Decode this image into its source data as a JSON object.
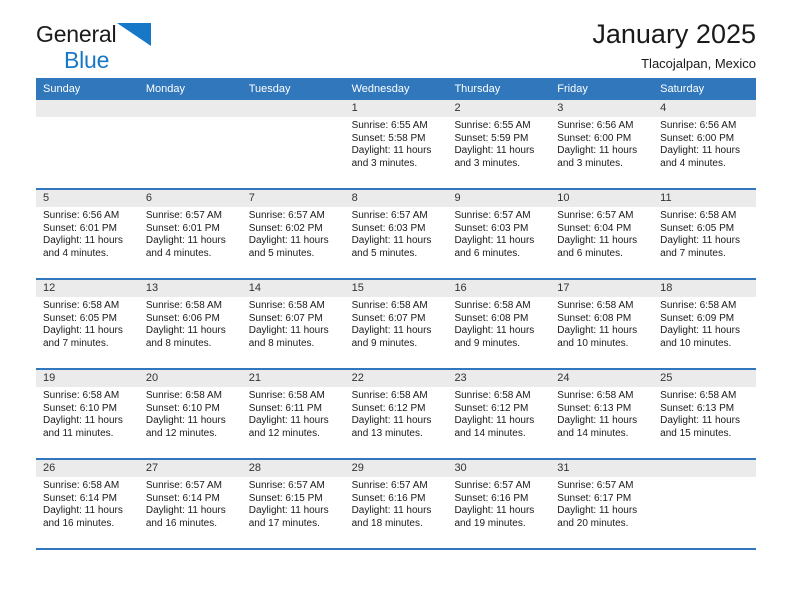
{
  "brand": {
    "word1": "General",
    "word2": "Blue",
    "triangle_color": "#1878c8",
    "text_color": "#1a1a1a"
  },
  "header": {
    "title": "January 2025",
    "subtitle": "Tlacojalpan, Mexico"
  },
  "theme": {
    "header_band": "#3077bc",
    "daynum_band": "#ebebeb",
    "separator": "#3077bc"
  },
  "weekday_headers": [
    "Sunday",
    "Monday",
    "Tuesday",
    "Wednesday",
    "Thursday",
    "Friday",
    "Saturday"
  ],
  "weeks": [
    [
      {
        "day": "",
        "empty": true,
        "sunrise": "",
        "sunset": "",
        "daylight1": "",
        "daylight2": ""
      },
      {
        "day": "",
        "empty": true,
        "sunrise": "",
        "sunset": "",
        "daylight1": "",
        "daylight2": ""
      },
      {
        "day": "",
        "empty": true,
        "sunrise": "",
        "sunset": "",
        "daylight1": "",
        "daylight2": ""
      },
      {
        "day": "1",
        "empty": false,
        "sunrise": "Sunrise: 6:55 AM",
        "sunset": "Sunset: 5:58 PM",
        "daylight1": "Daylight: 11 hours",
        "daylight2": "and 3 minutes."
      },
      {
        "day": "2",
        "empty": false,
        "sunrise": "Sunrise: 6:55 AM",
        "sunset": "Sunset: 5:59 PM",
        "daylight1": "Daylight: 11 hours",
        "daylight2": "and 3 minutes."
      },
      {
        "day": "3",
        "empty": false,
        "sunrise": "Sunrise: 6:56 AM",
        "sunset": "Sunset: 6:00 PM",
        "daylight1": "Daylight: 11 hours",
        "daylight2": "and 3 minutes."
      },
      {
        "day": "4",
        "empty": false,
        "sunrise": "Sunrise: 6:56 AM",
        "sunset": "Sunset: 6:00 PM",
        "daylight1": "Daylight: 11 hours",
        "daylight2": "and 4 minutes."
      }
    ],
    [
      {
        "day": "5",
        "empty": false,
        "sunrise": "Sunrise: 6:56 AM",
        "sunset": "Sunset: 6:01 PM",
        "daylight1": "Daylight: 11 hours",
        "daylight2": "and 4 minutes."
      },
      {
        "day": "6",
        "empty": false,
        "sunrise": "Sunrise: 6:57 AM",
        "sunset": "Sunset: 6:01 PM",
        "daylight1": "Daylight: 11 hours",
        "daylight2": "and 4 minutes."
      },
      {
        "day": "7",
        "empty": false,
        "sunrise": "Sunrise: 6:57 AM",
        "sunset": "Sunset: 6:02 PM",
        "daylight1": "Daylight: 11 hours",
        "daylight2": "and 5 minutes."
      },
      {
        "day": "8",
        "empty": false,
        "sunrise": "Sunrise: 6:57 AM",
        "sunset": "Sunset: 6:03 PM",
        "daylight1": "Daylight: 11 hours",
        "daylight2": "and 5 minutes."
      },
      {
        "day": "9",
        "empty": false,
        "sunrise": "Sunrise: 6:57 AM",
        "sunset": "Sunset: 6:03 PM",
        "daylight1": "Daylight: 11 hours",
        "daylight2": "and 6 minutes."
      },
      {
        "day": "10",
        "empty": false,
        "sunrise": "Sunrise: 6:57 AM",
        "sunset": "Sunset: 6:04 PM",
        "daylight1": "Daylight: 11 hours",
        "daylight2": "and 6 minutes."
      },
      {
        "day": "11",
        "empty": false,
        "sunrise": "Sunrise: 6:58 AM",
        "sunset": "Sunset: 6:05 PM",
        "daylight1": "Daylight: 11 hours",
        "daylight2": "and 7 minutes."
      }
    ],
    [
      {
        "day": "12",
        "empty": false,
        "sunrise": "Sunrise: 6:58 AM",
        "sunset": "Sunset: 6:05 PM",
        "daylight1": "Daylight: 11 hours",
        "daylight2": "and 7 minutes."
      },
      {
        "day": "13",
        "empty": false,
        "sunrise": "Sunrise: 6:58 AM",
        "sunset": "Sunset: 6:06 PM",
        "daylight1": "Daylight: 11 hours",
        "daylight2": "and 8 minutes."
      },
      {
        "day": "14",
        "empty": false,
        "sunrise": "Sunrise: 6:58 AM",
        "sunset": "Sunset: 6:07 PM",
        "daylight1": "Daylight: 11 hours",
        "daylight2": "and 8 minutes."
      },
      {
        "day": "15",
        "empty": false,
        "sunrise": "Sunrise: 6:58 AM",
        "sunset": "Sunset: 6:07 PM",
        "daylight1": "Daylight: 11 hours",
        "daylight2": "and 9 minutes."
      },
      {
        "day": "16",
        "empty": false,
        "sunrise": "Sunrise: 6:58 AM",
        "sunset": "Sunset: 6:08 PM",
        "daylight1": "Daylight: 11 hours",
        "daylight2": "and 9 minutes."
      },
      {
        "day": "17",
        "empty": false,
        "sunrise": "Sunrise: 6:58 AM",
        "sunset": "Sunset: 6:08 PM",
        "daylight1": "Daylight: 11 hours",
        "daylight2": "and 10 minutes."
      },
      {
        "day": "18",
        "empty": false,
        "sunrise": "Sunrise: 6:58 AM",
        "sunset": "Sunset: 6:09 PM",
        "daylight1": "Daylight: 11 hours",
        "daylight2": "and 10 minutes."
      }
    ],
    [
      {
        "day": "19",
        "empty": false,
        "sunrise": "Sunrise: 6:58 AM",
        "sunset": "Sunset: 6:10 PM",
        "daylight1": "Daylight: 11 hours",
        "daylight2": "and 11 minutes."
      },
      {
        "day": "20",
        "empty": false,
        "sunrise": "Sunrise: 6:58 AM",
        "sunset": "Sunset: 6:10 PM",
        "daylight1": "Daylight: 11 hours",
        "daylight2": "and 12 minutes."
      },
      {
        "day": "21",
        "empty": false,
        "sunrise": "Sunrise: 6:58 AM",
        "sunset": "Sunset: 6:11 PM",
        "daylight1": "Daylight: 11 hours",
        "daylight2": "and 12 minutes."
      },
      {
        "day": "22",
        "empty": false,
        "sunrise": "Sunrise: 6:58 AM",
        "sunset": "Sunset: 6:12 PM",
        "daylight1": "Daylight: 11 hours",
        "daylight2": "and 13 minutes."
      },
      {
        "day": "23",
        "empty": false,
        "sunrise": "Sunrise: 6:58 AM",
        "sunset": "Sunset: 6:12 PM",
        "daylight1": "Daylight: 11 hours",
        "daylight2": "and 14 minutes."
      },
      {
        "day": "24",
        "empty": false,
        "sunrise": "Sunrise: 6:58 AM",
        "sunset": "Sunset: 6:13 PM",
        "daylight1": "Daylight: 11 hours",
        "daylight2": "and 14 minutes."
      },
      {
        "day": "25",
        "empty": false,
        "sunrise": "Sunrise: 6:58 AM",
        "sunset": "Sunset: 6:13 PM",
        "daylight1": "Daylight: 11 hours",
        "daylight2": "and 15 minutes."
      }
    ],
    [
      {
        "day": "26",
        "empty": false,
        "sunrise": "Sunrise: 6:58 AM",
        "sunset": "Sunset: 6:14 PM",
        "daylight1": "Daylight: 11 hours",
        "daylight2": "and 16 minutes."
      },
      {
        "day": "27",
        "empty": false,
        "sunrise": "Sunrise: 6:57 AM",
        "sunset": "Sunset: 6:14 PM",
        "daylight1": "Daylight: 11 hours",
        "daylight2": "and 16 minutes."
      },
      {
        "day": "28",
        "empty": false,
        "sunrise": "Sunrise: 6:57 AM",
        "sunset": "Sunset: 6:15 PM",
        "daylight1": "Daylight: 11 hours",
        "daylight2": "and 17 minutes."
      },
      {
        "day": "29",
        "empty": false,
        "sunrise": "Sunrise: 6:57 AM",
        "sunset": "Sunset: 6:16 PM",
        "daylight1": "Daylight: 11 hours",
        "daylight2": "and 18 minutes."
      },
      {
        "day": "30",
        "empty": false,
        "sunrise": "Sunrise: 6:57 AM",
        "sunset": "Sunset: 6:16 PM",
        "daylight1": "Daylight: 11 hours",
        "daylight2": "and 19 minutes."
      },
      {
        "day": "31",
        "empty": false,
        "sunrise": "Sunrise: 6:57 AM",
        "sunset": "Sunset: 6:17 PM",
        "daylight1": "Daylight: 11 hours",
        "daylight2": "and 20 minutes."
      },
      {
        "day": "",
        "empty": true,
        "sunrise": "",
        "sunset": "",
        "daylight1": "",
        "daylight2": ""
      }
    ]
  ]
}
